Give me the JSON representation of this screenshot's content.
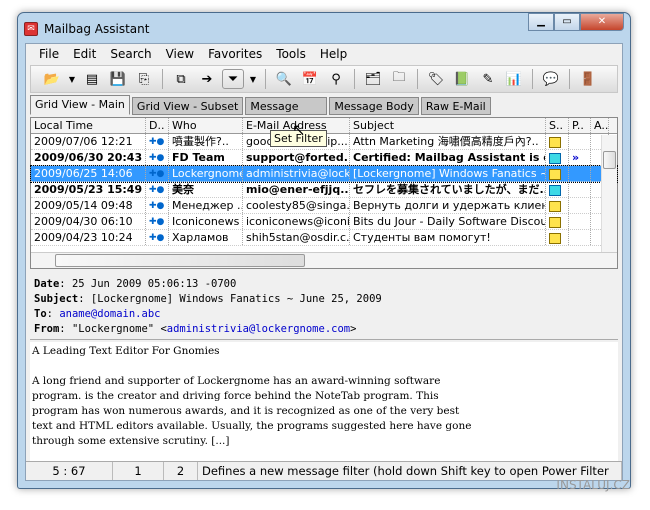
{
  "window": {
    "title": "Mailbag Assistant"
  },
  "menu": [
    "File",
    "Edit",
    "Search",
    "View",
    "Favorites",
    "Tools",
    "Help"
  ],
  "tooltip": "Set Filter",
  "tabs": [
    "Grid View - Main",
    "Grid View - Subset",
    "Message",
    "Message Body",
    "Raw E-Mail"
  ],
  "grid": {
    "columns": [
      "Local Time",
      "D..",
      "Who",
      "E-Mail Address",
      "Subject",
      "S..",
      "P..",
      "A.."
    ],
    "rows": [
      {
        "time": "2009/07/06  12:21",
        "who": "噴畫製作?..",
        "email": "goodoutput@vip....",
        "subject": "Attn Marketing 海嘯價高精度戶內?..",
        "bold": false,
        "sel": false,
        "env": "yellow",
        "p": ""
      },
      {
        "time": "2009/06/30  20:43",
        "who": "FD Team",
        "email": "support@forted...",
        "subject": "Certified: Mailbag Assistant is c...",
        "bold": true,
        "sel": false,
        "env": "cyan",
        "p": "»"
      },
      {
        "time": "2009/06/25  14:06",
        "who": "Lockergnome",
        "email": "administrivia@lock...",
        "subject": "[Lockergnome] Windows Fanatics ~ ...",
        "bold": false,
        "sel": true,
        "env": "yellow",
        "p": ""
      },
      {
        "time": "2009/05/23  15:49",
        "who": "美奈",
        "email": "mio@ener-efjjq...",
        "subject": "セフレを募集されていましたが、まだ...",
        "bold": true,
        "sel": false,
        "env": "cyan",
        "p": ""
      },
      {
        "time": "2009/05/14  09:48",
        "who": "Менеджер ...",
        "email": "coolesty85@singa...",
        "subject": "Вернуть долги и удержать клиен...",
        "bold": false,
        "sel": false,
        "env": "yellow",
        "p": ""
      },
      {
        "time": "2009/04/30  06:10",
        "who": "Iconiconews",
        "email": "iconiconews@iconi...",
        "subject": "Bits du Jour - Daily Software Discou...",
        "bold": false,
        "sel": false,
        "env": "yellow",
        "p": ""
      },
      {
        "time": "2009/04/23  10:24",
        "who": "Харламов",
        "email": "shih5stan@osdir.c...",
        "subject": "Студенты вам помогут!",
        "bold": false,
        "sel": false,
        "env": "yellow",
        "p": ""
      }
    ]
  },
  "header": {
    "date_label": "Date",
    "date": "25 Jun 2009 05:06:13 -0700",
    "subject_label": "Subject",
    "subject": "[Lockergnome] Windows Fanatics ~ June 25, 2009",
    "to_label": "To",
    "to": "aname@domain.abc",
    "from_label": "From",
    "from_name": "\"Lockergnome\" <",
    "from_email": "administrivia@lockergnome.com",
    "from_end": ">"
  },
  "body": "A Leading Text Editor For Gnomies\n\nA long friend and supporter of Lockergnome has an award-winning software\nprogram. is the creator and driving force behind the NoteTab program. This\nprogram has won numerous awards, and it is recognized as one of the very best\ntext and HTML editors available. Usually, the programs suggested here have gone\nthrough some extensive scrutiny. [...]",
  "status": {
    "pos": "5 : 67",
    "a": "1",
    "b": "2",
    "message": "Defines a new message filter (hold down Shift key to open Power Filter"
  },
  "watermark": "INSTALUJ.CZ"
}
